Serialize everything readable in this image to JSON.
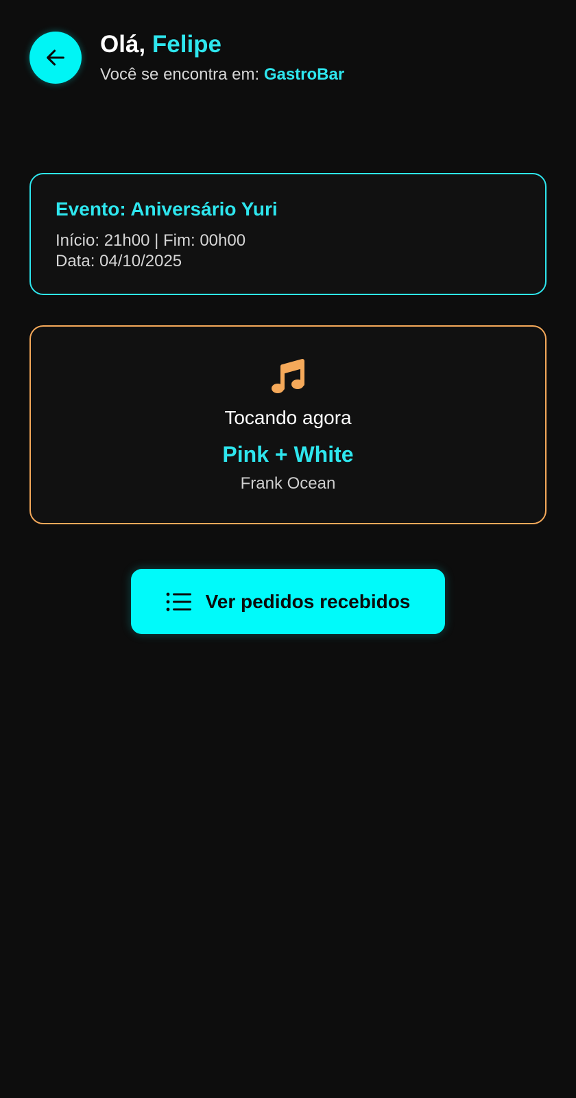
{
  "header": {
    "greeting_prefix": "Olá,",
    "user_name": "Felipe",
    "location_prefix": "Você se encontra em:",
    "venue_name": "GastroBar",
    "back_icon": "arrow-left-icon"
  },
  "event": {
    "title": "Evento: Aniversário Yuri",
    "time_line": "Início: 21h00 | Fim: 00h00",
    "date_line": "Data: 04/10/2025"
  },
  "now_playing": {
    "icon": "music-note-icon",
    "label": "Tocando agora",
    "song": "Pink + White",
    "artist": "Frank Ocean"
  },
  "actions": {
    "orders_button_label": "Ver pedidos recebidos",
    "orders_button_icon": "list-icon"
  },
  "colors": {
    "background": "#0d0d0d",
    "accent_cyan": "#00f5f5",
    "accent_cyan_text": "#2ee6ee",
    "accent_orange": "#f5a95a",
    "card_background": "#111111"
  }
}
